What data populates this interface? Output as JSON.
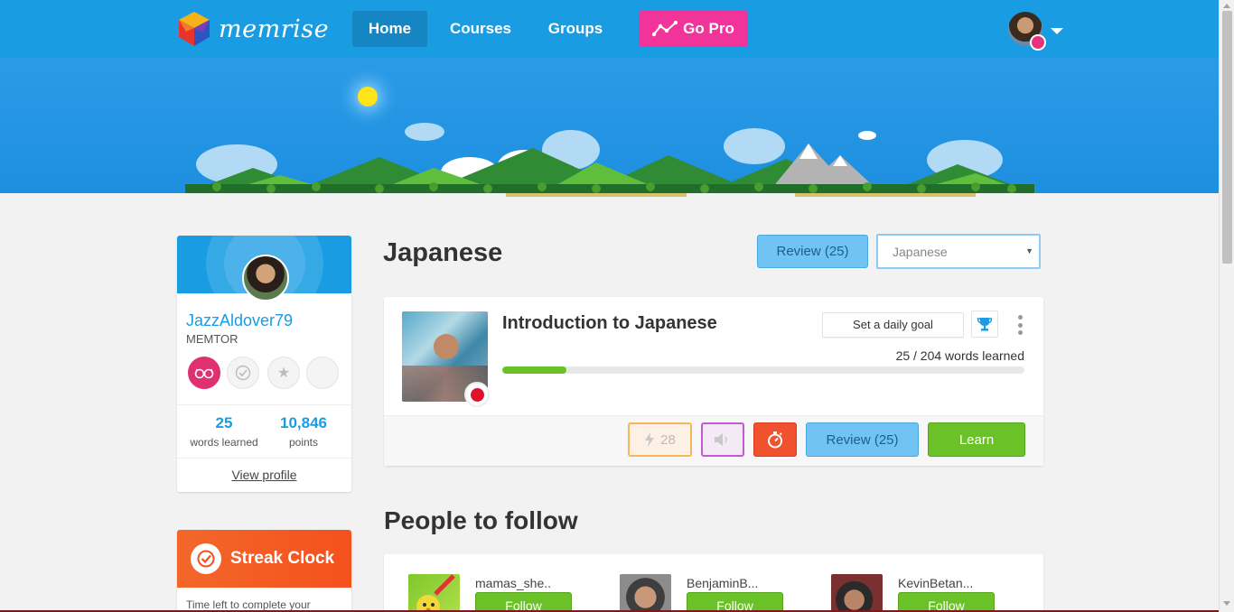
{
  "nav": {
    "logo_text": "memrise",
    "home": "Home",
    "courses": "Courses",
    "groups": "Groups",
    "gopro": "Go Pro"
  },
  "profile": {
    "username": "JazzAldover79",
    "title": "MEMTOR",
    "words_learned": "25",
    "words_learned_label": "words learned",
    "points": "10,846",
    "points_label": "points",
    "view_profile": "View profile"
  },
  "streak": {
    "title": "Streak Clock",
    "text": "Time left to complete your"
  },
  "main": {
    "heading": "Japanese",
    "review_button": "Review (25)",
    "language_select": "Japanese"
  },
  "course": {
    "title": "Introduction to Japanese",
    "daily_goal_button": "Set a daily goal",
    "words_progress_text": "25 / 204 words learned",
    "words_learned": 25,
    "words_total": 204,
    "speed_review_count": "28",
    "review_button": "Review (25)",
    "learn_button": "Learn"
  },
  "people": {
    "heading": "People to follow",
    "follow_label": "Follow",
    "items": [
      {
        "name": "mamas_she.."
      },
      {
        "name": "BenjaminB..."
      },
      {
        "name": "KevinBetan..."
      }
    ]
  },
  "colors": {
    "brand_blue": "#1a9ce3",
    "gopro_pink": "#f0349a",
    "learn_green": "#6ac228",
    "review_blue": "#70c3f2",
    "streak_orange": "#f4511e"
  }
}
